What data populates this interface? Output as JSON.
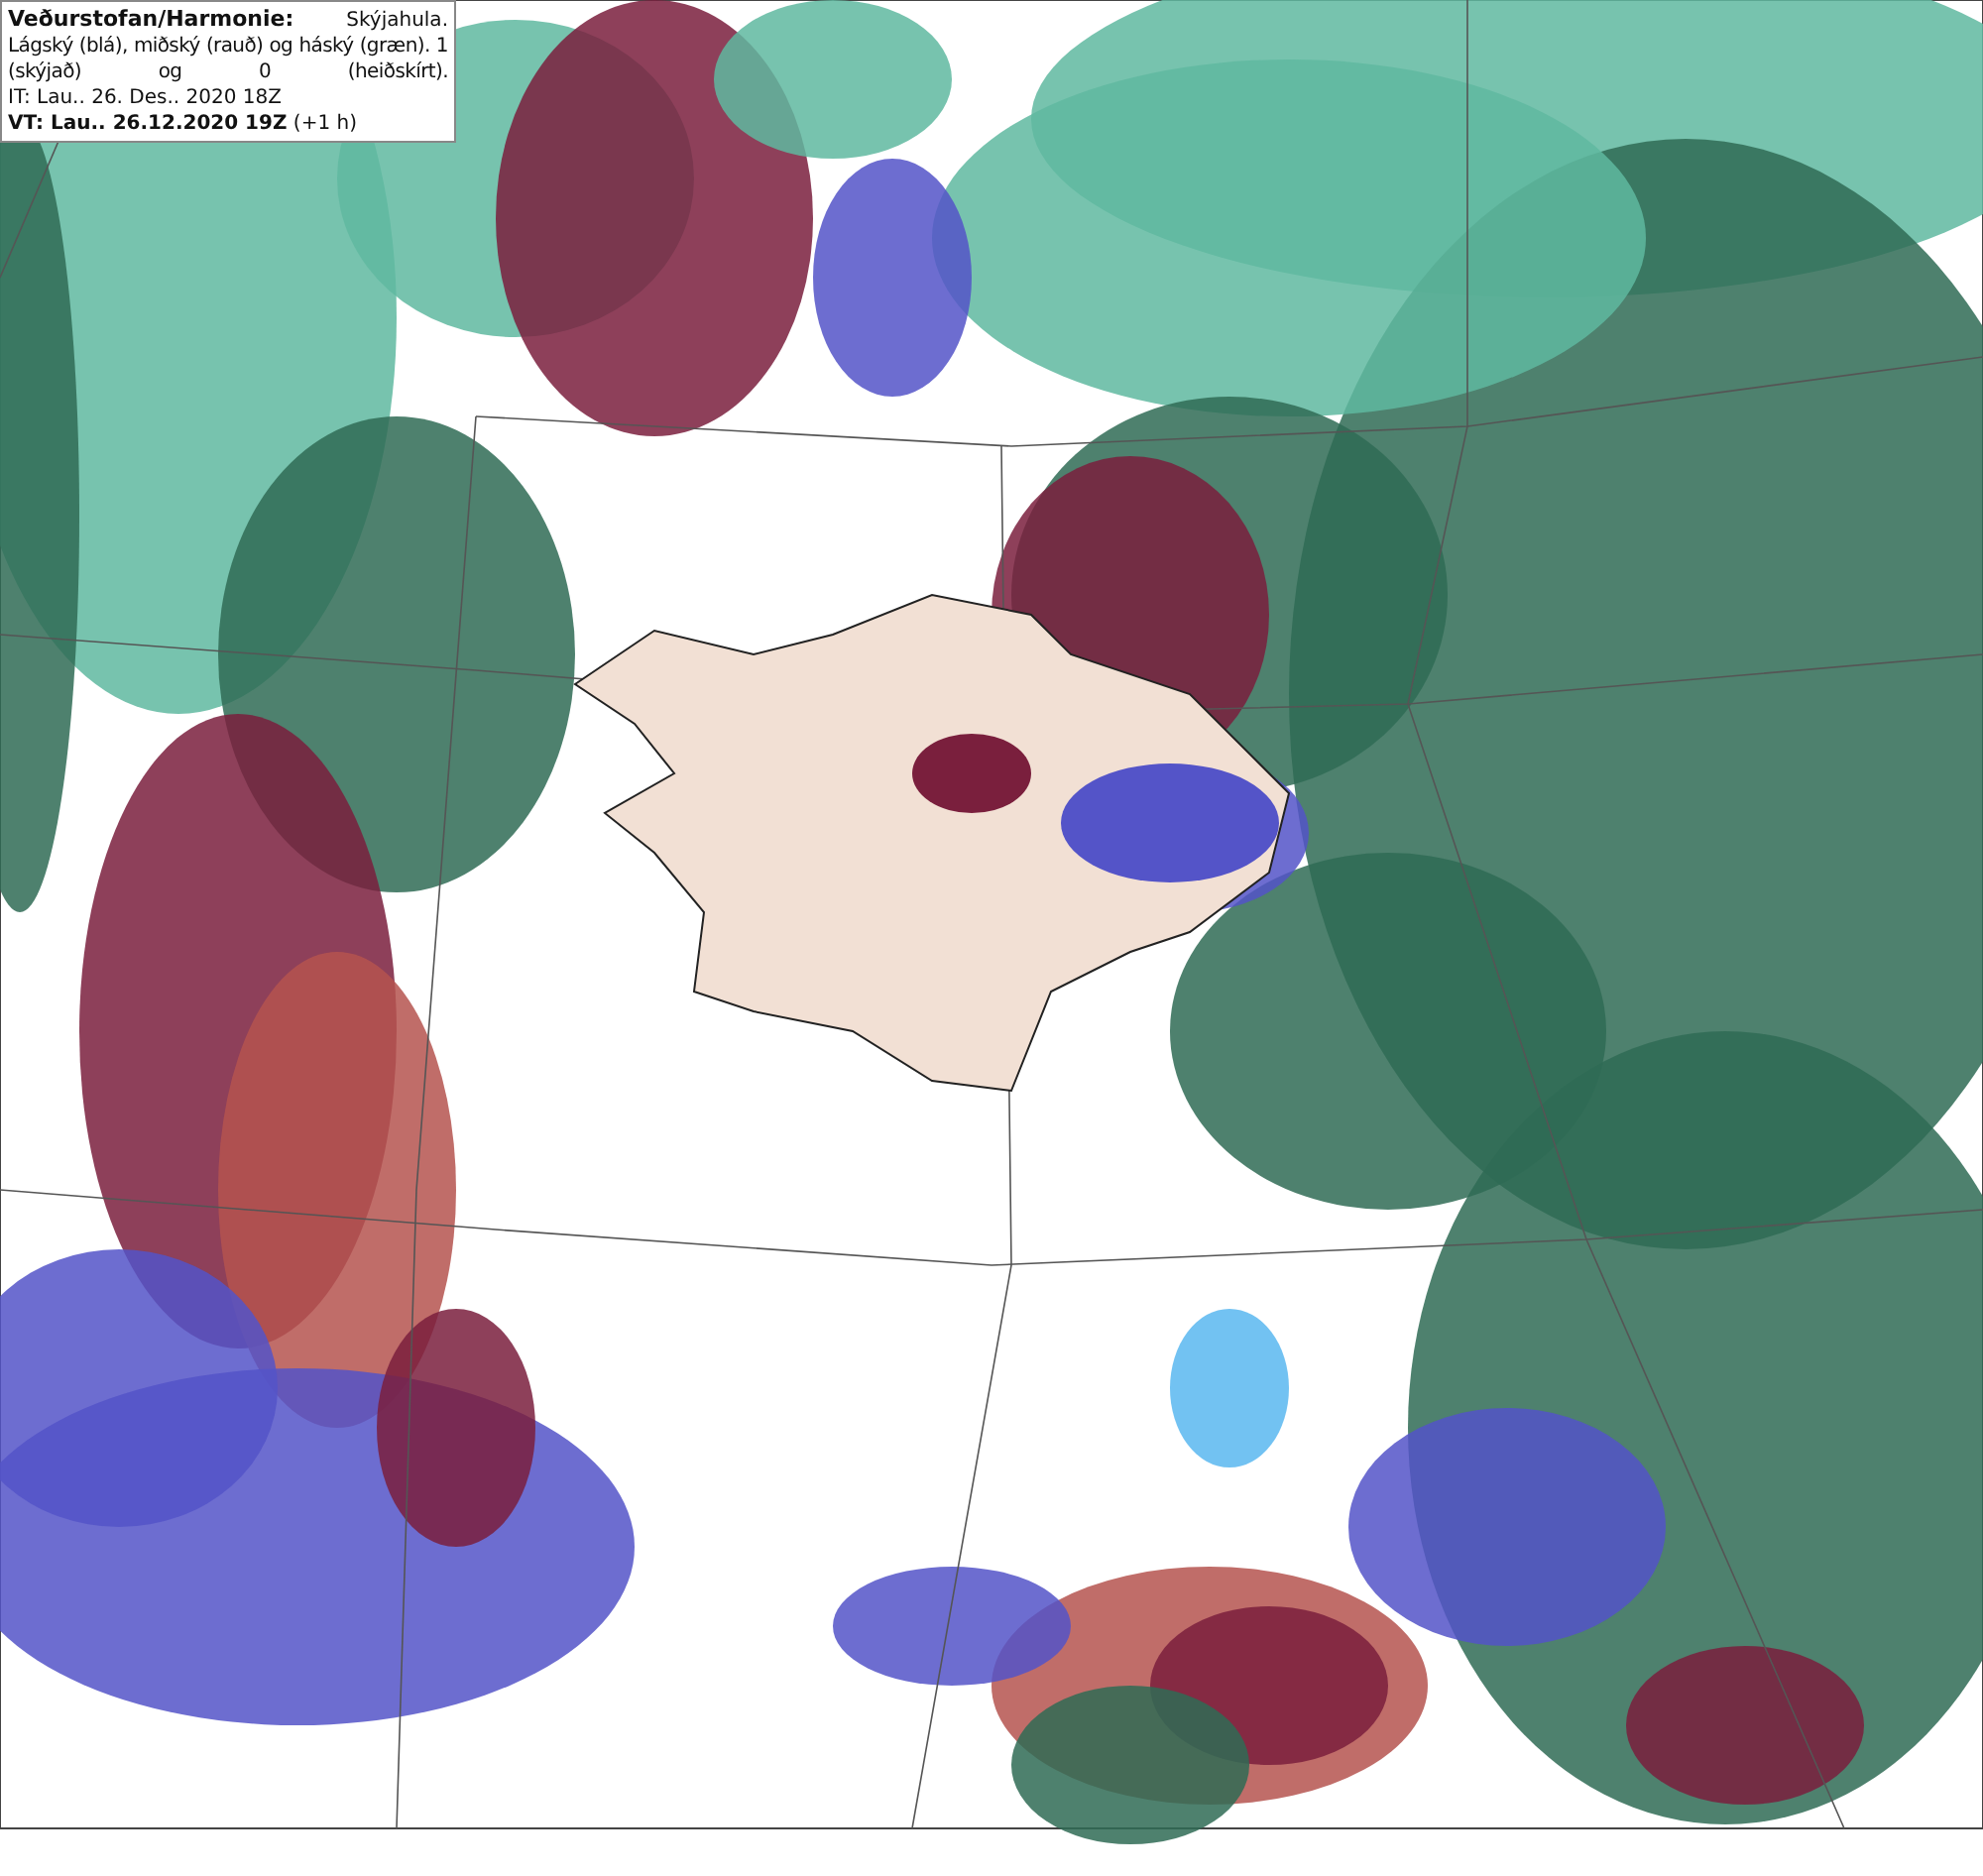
{
  "legend": {
    "title": "Veðurstofan/Harmonie:",
    "product": "Skýjahula.",
    "description": "Lágský (blá), miðský (rauð) og háský (græn). 1 (skýjað) og 0 (heiðskírt).",
    "analysis_time": "IT: Lau.. 26. Des.. 2020 18Z",
    "valid_time": "**VT: Lau.. 26.12.2020 19Z** (+1 h)"
  }
}
